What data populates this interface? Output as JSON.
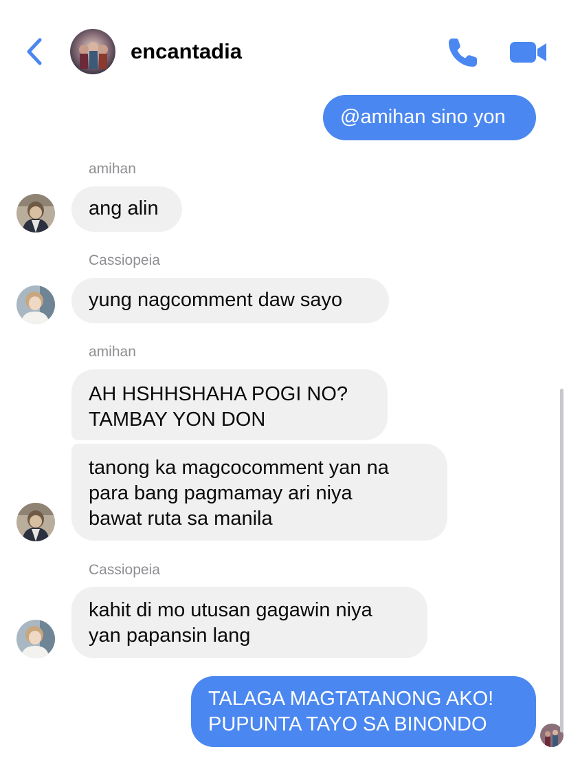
{
  "header": {
    "title": "encantadia",
    "back_icon": "chevron-left-icon",
    "call_icon": "phone-icon",
    "video_icon": "video-camera-icon",
    "accent_color": "#4a87f0"
  },
  "messages": [
    {
      "direction": "out",
      "text": "@amihan sino yon"
    },
    {
      "direction": "in",
      "sender": "amihan",
      "lines": [
        "ang alin"
      ]
    },
    {
      "direction": "in",
      "sender": "Cassiopeia",
      "lines": [
        "yung nagcomment daw sayo"
      ]
    },
    {
      "direction": "in",
      "sender": "amihan",
      "lines": [
        "AH HSHHSHAHA POGI NO?",
        "TAMBAY YON DON"
      ]
    },
    {
      "direction": "in",
      "lines": [
        "tanong ka magcocomment yan na",
        "para bang pagmamay ari niya",
        "bawat ruta sa manila"
      ]
    },
    {
      "direction": "in",
      "sender": "Cassiopeia",
      "lines": [
        "kahit di mo utusan gagawin niya",
        "yan papansin lang"
      ]
    },
    {
      "direction": "out",
      "lines": [
        "TALAGA MAGTATANONG AKO!",
        "PUPUNTA TAYO SA BINONDO"
      ]
    }
  ]
}
